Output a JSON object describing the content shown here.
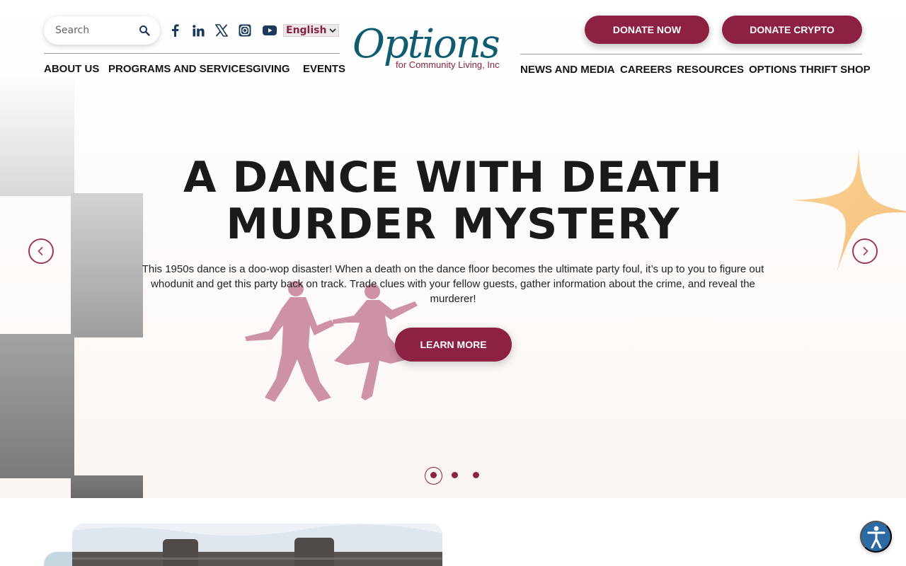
{
  "header": {
    "search": {
      "placeholder": "Search"
    },
    "social_icons": [
      "facebook-icon",
      "linkedin-icon",
      "x-icon",
      "instagram-icon",
      "youtube-icon"
    ],
    "language": {
      "selected": "English"
    },
    "logo": {
      "word": "Options",
      "subtitle": "for Community Living, Inc"
    },
    "nav_left": [
      "ABOUT US",
      "PROGRAMS AND SERVICES",
      "GIVING",
      "EVENTS"
    ],
    "nav_right": [
      "NEWS AND MEDIA",
      "CAREERS",
      "RESOURCES",
      "OPTIONS THRIFT SHOP"
    ],
    "donate_now": "DONATE NOW",
    "donate_crypto": "DONATE CRYPTO"
  },
  "hero": {
    "title_line1": "A DANCE WITH DEATH",
    "title_line2": "MURDER MYSTERY",
    "body": "This 1950s dance is a doo-wop disaster! When a death on the dance floor becomes the ultimate party foul, it’s up to you to figure out whodunit and get this party back on track. Trade clues with your fellow guests, gather information about the crime, and reveal the murderer!",
    "cta": "LEARN MORE",
    "slides": 3,
    "active_slide": 1
  },
  "colors": {
    "brand_maroon": "#8c2142",
    "brand_teal": "#0f5b6f",
    "icon_navy": "#1b3a5c",
    "accessibility_blue": "#2b6aa3",
    "sparkle_orange": "#f6c17a"
  }
}
